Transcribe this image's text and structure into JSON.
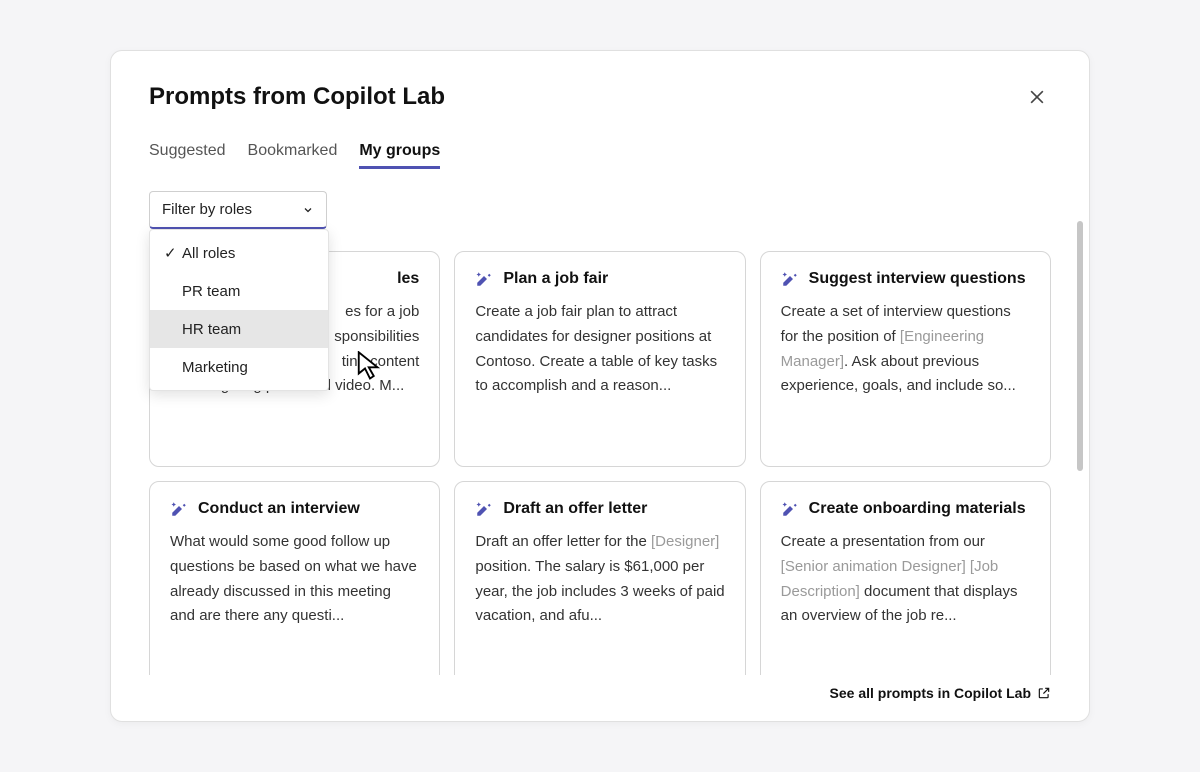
{
  "dialog": {
    "title": "Prompts from Copilot Lab"
  },
  "tabs": [
    {
      "label": "Suggested"
    },
    {
      "label": "Bookmarked"
    },
    {
      "label": "My groups"
    }
  ],
  "filter": {
    "label": "Filter by roles",
    "options": [
      {
        "label": "All roles",
        "checked": true
      },
      {
        "label": "PR team",
        "checked": false
      },
      {
        "label": "HR team",
        "checked": false,
        "hover": true
      },
      {
        "label": "Marketing",
        "checked": false
      }
    ]
  },
  "cards": [
    {
      "title_suffix": "les",
      "body_parts": [
        {
          "text": "es for a job"
        },
        {
          "text": "sponsibilities"
        },
        {
          "text": "ting content"
        },
        {
          "text": "including blog posts and video. M..."
        }
      ]
    },
    {
      "title": "Plan a job fair",
      "body": "Create a job fair plan to attract candidates for designer positions at Contoso. Create a table of key tasks to accomplish and a reason..."
    },
    {
      "title": "Suggest interview questions",
      "body_pre": "Create a set of interview questions for the position of ",
      "body_ph": "[Engineering Manager]",
      "body_post": ". Ask about previous experience, goals, and include so..."
    },
    {
      "title": "Conduct an interview",
      "body": "What would some good follow up questions be based on what we have already discussed in this meeting and are there any questi..."
    },
    {
      "title": "Draft an offer letter",
      "body_pre": "Draft an offer letter for the ",
      "body_ph": "[Designer]",
      "body_post": " position. The salary is $61,000 per year, the job includes 3 weeks of paid vacation, and afu..."
    },
    {
      "title": "Create onboarding materials",
      "body_pre": "Create a presentation from our ",
      "body_ph": "[Senior animation Designer] [Job Description]",
      "body_post": " document that displays an overview of the job re..."
    }
  ],
  "footer": {
    "link": "See all prompts in Copilot Lab"
  }
}
